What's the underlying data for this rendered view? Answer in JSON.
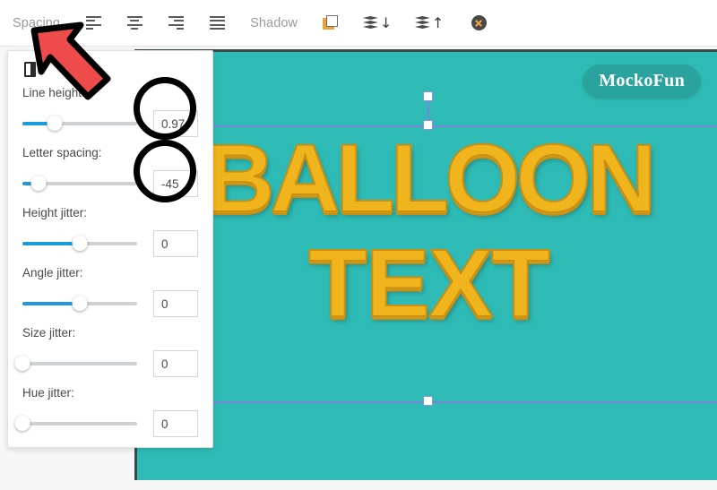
{
  "toolbar": {
    "spacing_label": "Spacing",
    "shadow_label": "Shadow",
    "icons": [
      {
        "name": "align-left-icon"
      },
      {
        "name": "align-center-icon"
      },
      {
        "name": "align-right-icon"
      },
      {
        "name": "align-justify-icon"
      },
      {
        "name": "duplicate-icon"
      },
      {
        "name": "move-layer-down-icon"
      },
      {
        "name": "move-layer-up-icon"
      },
      {
        "name": "delete-object-icon"
      }
    ],
    "layer_down_arrow": "↓",
    "layer_up_arrow": "↑"
  },
  "panel": {
    "controls": [
      {
        "label": "Line height:",
        "value": "0.97",
        "fill_pct": 28,
        "thumb_pct": 28
      },
      {
        "label": "Letter spacing:",
        "value": "-45",
        "fill_pct": 14,
        "thumb_pct": 14
      },
      {
        "label": "Height jitter:",
        "value": "0",
        "fill_pct": 50,
        "thumb_pct": 50
      },
      {
        "label": "Angle jitter:",
        "value": "0",
        "fill_pct": 50,
        "thumb_pct": 50
      },
      {
        "label": "Size jitter:",
        "value": "0",
        "fill_pct": 0,
        "thumb_pct": 0
      },
      {
        "label": "Hue jitter:",
        "value": "0",
        "fill_pct": 0,
        "thumb_pct": 0
      }
    ]
  },
  "canvas": {
    "background_color": "#2fbbb5",
    "badge_label": "MockoFun",
    "text_line_1": "BALLOON",
    "text_line_2": "TEXT",
    "text_color": "#f0b41c"
  },
  "colors": {
    "slider_fill": "#1e9bdd",
    "selection": "#7b85d8",
    "annotation": "#ee4b4b"
  }
}
